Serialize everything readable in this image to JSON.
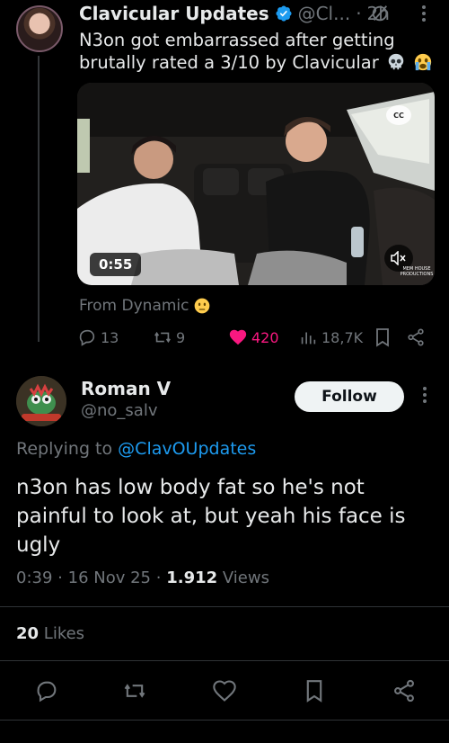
{
  "parent": {
    "name": "Clavicular Updates",
    "handle": "@Cl...",
    "separator": "·",
    "time": "2h",
    "text": "N3on got embarrassed after getting brutally rated a 3/10 by Clavicular",
    "video": {
      "duration": "0:55",
      "cc_label": "CC",
      "watermark": "MEM HOUSE PRODUCTIONS"
    },
    "from_text": "From Dynamic",
    "stats": {
      "replies": "13",
      "reposts": "9",
      "likes": "420",
      "views": "18,7K"
    }
  },
  "reply": {
    "name": "Roman V",
    "handle": "@no_salv",
    "follow_label": "Follow",
    "replying_prefix": "Replying to",
    "replying_mention": "@ClavOUpdates",
    "text": "n3on has low body fat so he's not painful to look at, but yeah his face is ugly",
    "time": "0:39",
    "date": "16 Nov 25",
    "dot": "·",
    "views_count": "1.912",
    "views_label": "Views",
    "likes_count": "20",
    "likes_label": "Likes"
  },
  "colors": {
    "background": "#000000",
    "text": "#e7e9ea",
    "muted": "#71767b",
    "accent": "#1d9bf0",
    "like": "#f91880",
    "separator": "#2f3336"
  },
  "icons": [
    "verified-badge-icon",
    "grok-icon",
    "more-icon",
    "skull-emoji",
    "crying-emoji",
    "cc-icon",
    "mute-icon",
    "neutral-face-emoji",
    "reply-icon",
    "repost-icon",
    "heart-icon",
    "views-icon",
    "bookmark-icon",
    "share-icon"
  ]
}
